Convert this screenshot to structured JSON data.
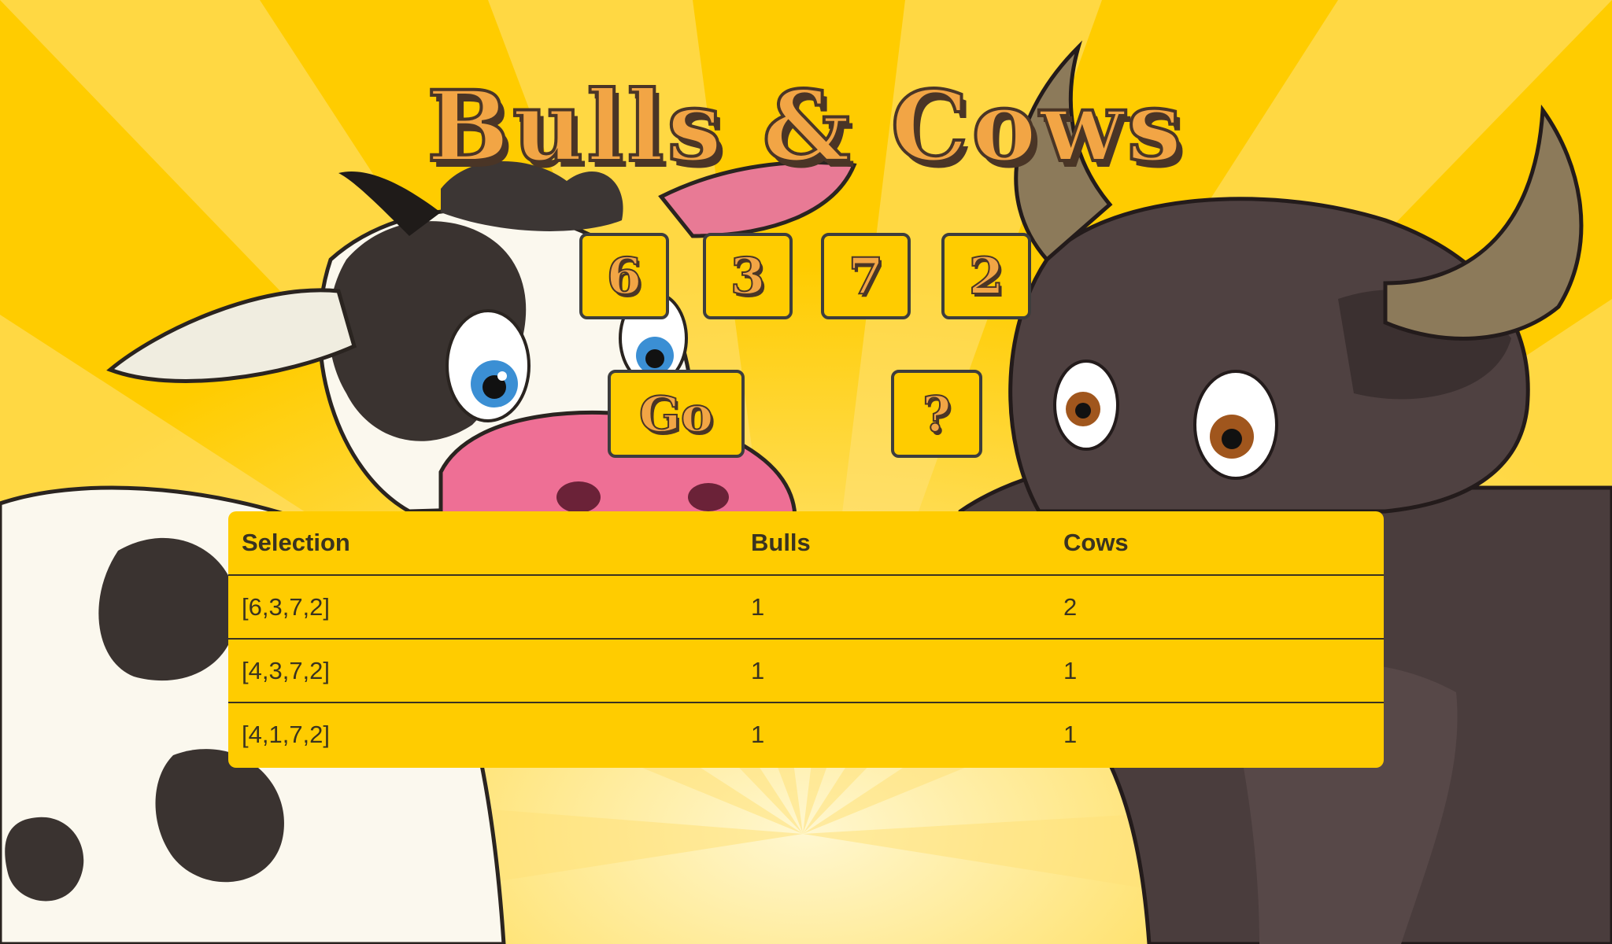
{
  "game": {
    "title": "Bulls & Cows",
    "digits": [
      "6",
      "3",
      "7",
      "2"
    ],
    "go_label": "Go",
    "help_label": "?"
  },
  "results": {
    "headers": [
      "Selection",
      "Bulls",
      "Cows"
    ],
    "rows": [
      [
        "[6,3,7,2]",
        "1",
        "2"
      ],
      [
        "[4,3,7,2]",
        "1",
        "1"
      ],
      [
        "[4,1,7,2]",
        "1",
        "1"
      ]
    ]
  },
  "colors": {
    "background": "#ffcc00",
    "title_fill": "#f2a545",
    "outline": "#4a3526"
  }
}
